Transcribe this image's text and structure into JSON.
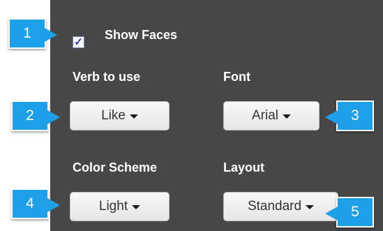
{
  "settings": {
    "show_faces": {
      "label": "Show Faces",
      "checked": true
    },
    "verb": {
      "label": "Verb to use",
      "selected": "Like"
    },
    "font": {
      "label": "Font",
      "selected": "Arial"
    },
    "color_scheme": {
      "label": "Color Scheme",
      "selected": "Light"
    },
    "layout": {
      "label": "Layout",
      "selected": "Standard"
    }
  },
  "callouts": [
    "1",
    "2",
    "3",
    "4",
    "5"
  ],
  "colors": {
    "panel": "#474747",
    "callout": "#1ea0e8",
    "checkmark": "#2b3aa8"
  },
  "icons": {
    "checkbox_mark": "✓",
    "dropdown": "caret-down-icon"
  }
}
